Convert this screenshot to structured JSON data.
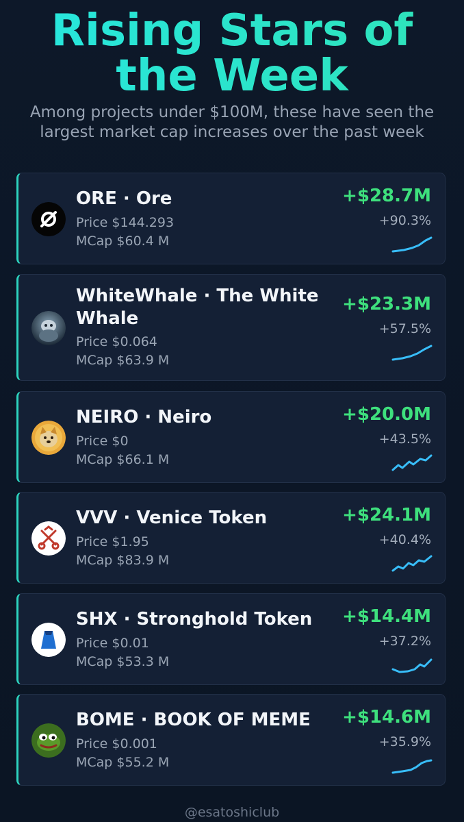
{
  "header": {
    "title_line1": "Rising Stars of",
    "title_line2": "the Week",
    "subtitle": "Among projects under $100M, these have seen the largest market cap increases over the past week"
  },
  "tokens": [
    {
      "name": "ORE · Ore",
      "price": "Price $144.293",
      "mcap": "MCap $60.4 M",
      "gain": "+$28.7M",
      "pct": "+90.3%",
      "avatar_icon": "ore-logo-icon"
    },
    {
      "name": "WhiteWhale · The White Whale",
      "price": "Price $0.064",
      "mcap": "MCap $63.9 M",
      "gain": "+$23.3M",
      "pct": "+57.5%",
      "avatar_icon": "whitewhale-logo-icon"
    },
    {
      "name": "NEIRO · Neiro",
      "price": "Price $0",
      "mcap": "MCap $66.1 M",
      "gain": "+$20.0M",
      "pct": "+43.5%",
      "avatar_icon": "neiro-dog-logo-icon"
    },
    {
      "name": "VVV · Venice Token",
      "price": "Price $1.95",
      "mcap": "MCap $83.9 M",
      "gain": "+$24.1M",
      "pct": "+40.4%",
      "avatar_icon": "venice-keys-logo-icon"
    },
    {
      "name": "SHX · Stronghold Token",
      "price": "Price $0.01",
      "mcap": "MCap $53.3 M",
      "gain": "+$14.4M",
      "pct": "+37.2%",
      "avatar_icon": "stronghold-logo-icon"
    },
    {
      "name": "BOME · BOOK OF MEME",
      "price": "Price $0.001",
      "mcap": "MCap $55.2 M",
      "gain": "+$14.6M",
      "pct": "+35.9%",
      "avatar_icon": "pepe-frog-logo-icon"
    }
  ],
  "footer": {
    "handle": "@esatoshiclub"
  },
  "colors": {
    "accent": "#2dd4bf",
    "gain": "#3ee07d",
    "spark": "#38bdf8",
    "background": "#0c1626"
  }
}
